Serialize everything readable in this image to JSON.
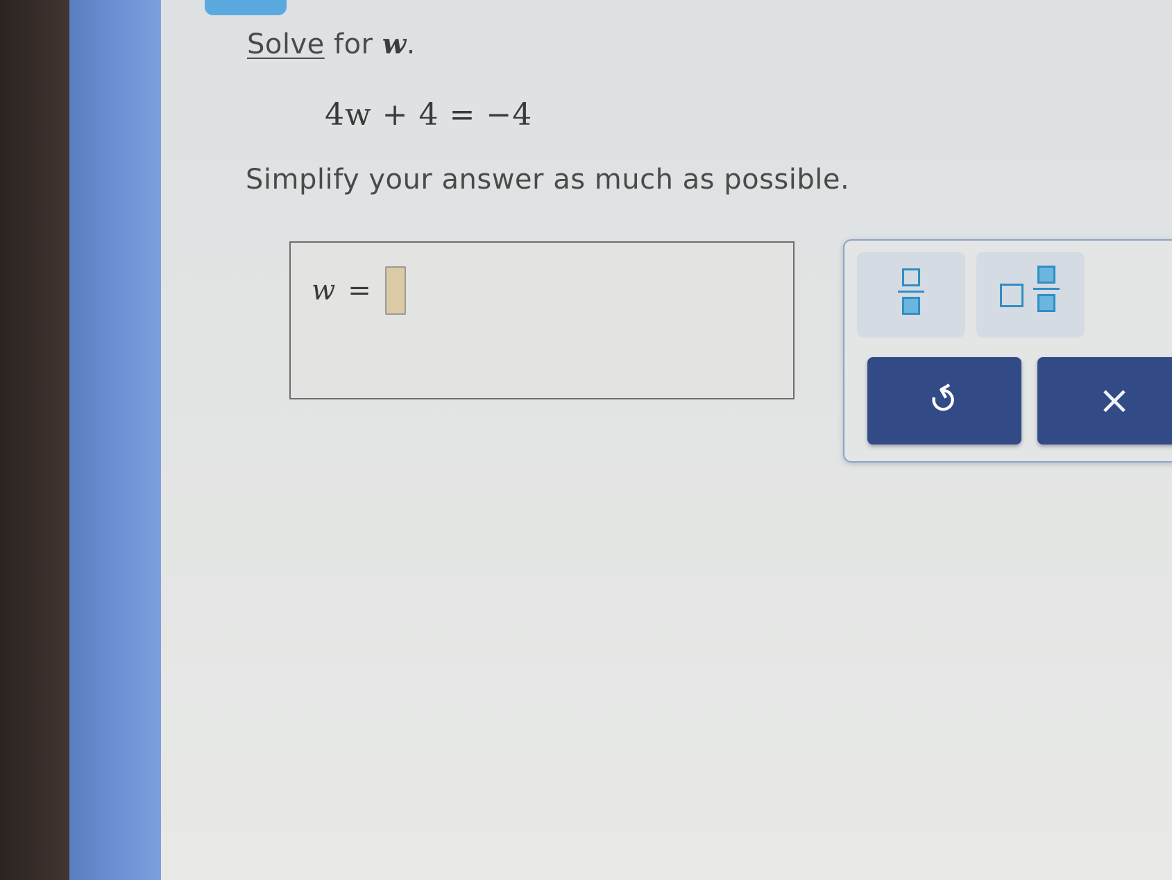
{
  "question": {
    "prompt_prefix": "Solve",
    "prompt_middle": " for ",
    "prompt_variable": "w",
    "prompt_suffix": ".",
    "equation": "4w + 4 = −4",
    "instruction": "Simplify your answer as much as possible."
  },
  "answer": {
    "variable": "w",
    "equals": "=",
    "value": ""
  },
  "toolbar": {
    "undo_symbol": "↺",
    "clear_symbol": "×"
  },
  "icons": {
    "fraction": "fraction-icon",
    "mixed_number": "mixed-number-icon",
    "undo": "undo-icon",
    "clear": "close-icon"
  },
  "colors": {
    "accent_blue": "#2f8ec4",
    "action_button": "#324a86",
    "input_fill": "#dccaa6",
    "side_strip": "#6d93d6"
  }
}
